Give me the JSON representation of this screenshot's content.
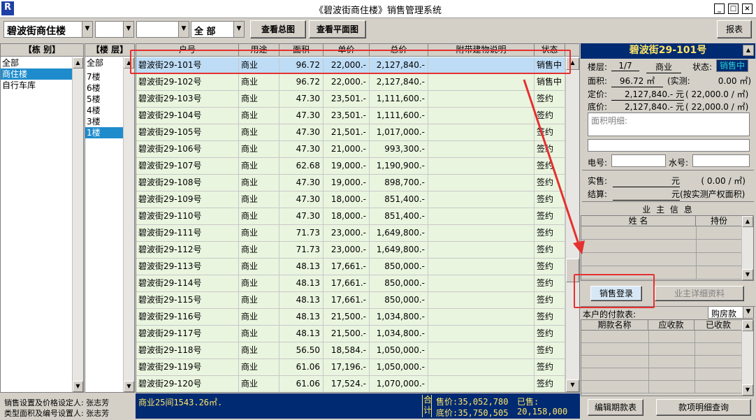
{
  "window": {
    "title": "《碧波街商住楼》销售管理系统",
    "app_icon": "R"
  },
  "toolbar": {
    "building": "碧波街商住楼",
    "combo2": "",
    "combo3": "",
    "scope": "全 部",
    "btn_overview": "查看总图",
    "btn_plan": "查看平面图",
    "btn_report": "报表"
  },
  "buildings": {
    "header": "【栋 别】",
    "items": [
      "全部",
      "商住楼",
      "自行车库"
    ],
    "selected": 1
  },
  "floors": {
    "header": "【楼 层】",
    "items": [
      "全部",
      "7楼",
      "6楼",
      "5楼",
      "4楼",
      "3楼",
      "1楼"
    ],
    "selected": 6
  },
  "grid": {
    "headers": [
      "户号",
      "用途",
      "面积",
      "单价",
      "总价",
      "附带建物说明",
      "状态"
    ],
    "rows": [
      [
        "碧波街29-101号",
        "商业",
        "96.72",
        "22,000.-",
        "2,127,840.-",
        "",
        "销售中"
      ],
      [
        "碧波街29-102号",
        "商业",
        "96.72",
        "22,000.-",
        "2,127,840.-",
        "",
        "销售中"
      ],
      [
        "碧波街29-103号",
        "商业",
        "47.30",
        "23,501.-",
        "1,111,600.-",
        "",
        "签约"
      ],
      [
        "碧波街29-104号",
        "商业",
        "47.30",
        "23,501.-",
        "1,111,600.-",
        "",
        "签约"
      ],
      [
        "碧波街29-105号",
        "商业",
        "47.30",
        "21,501.-",
        "1,017,000.-",
        "",
        "签约"
      ],
      [
        "碧波街29-106号",
        "商业",
        "47.30",
        "21,000.-",
        "993,300.-",
        "",
        "签约"
      ],
      [
        "碧波街29-107号",
        "商业",
        "62.68",
        "19,000.-",
        "1,190,900.-",
        "",
        "签约"
      ],
      [
        "碧波街29-108号",
        "商业",
        "47.30",
        "19,000.-",
        "898,700.-",
        "",
        "签约"
      ],
      [
        "碧波街29-109号",
        "商业",
        "47.30",
        "18,000.-",
        "851,400.-",
        "",
        "签约"
      ],
      [
        "碧波街29-110号",
        "商业",
        "47.30",
        "18,000.-",
        "851,400.-",
        "",
        "签约"
      ],
      [
        "碧波街29-111号",
        "商业",
        "71.73",
        "23,000.-",
        "1,649,800.-",
        "",
        "签约"
      ],
      [
        "碧波街29-112号",
        "商业",
        "71.73",
        "23,000.-",
        "1,649,800.-",
        "",
        "签约"
      ],
      [
        "碧波街29-113号",
        "商业",
        "48.13",
        "17,661.-",
        "850,000.-",
        "",
        "签约"
      ],
      [
        "碧波街29-114号",
        "商业",
        "48.13",
        "17,661.-",
        "850,000.-",
        "",
        "签约"
      ],
      [
        "碧波街29-115号",
        "商业",
        "48.13",
        "17,661.-",
        "850,000.-",
        "",
        "签约"
      ],
      [
        "碧波街29-116号",
        "商业",
        "48.13",
        "21,500.-",
        "1,034,800.-",
        "",
        "签约"
      ],
      [
        "碧波街29-117号",
        "商业",
        "48.13",
        "21,500.-",
        "1,034,800.-",
        "",
        "签约"
      ],
      [
        "碧波街29-118号",
        "商业",
        "56.50",
        "18,584.-",
        "1,050,000.-",
        "",
        "签约"
      ],
      [
        "碧波街29-119号",
        "商业",
        "61.06",
        "17,196.-",
        "1,050,000.-",
        "",
        "签约"
      ],
      [
        "碧波街29-120号",
        "商业",
        "61.06",
        "17,524.-",
        "1,070,000.-",
        "",
        "签约"
      ]
    ],
    "selected": 0
  },
  "summary": {
    "count_text": "商业25间1543.26㎡.",
    "total_label": "合计",
    "sale_label": "售价:",
    "sale_value": "35,052,780",
    "floor_label": "底价:",
    "floor_value": "35,750,505",
    "sold_label": "已售:",
    "sold_value": "20,158,000"
  },
  "left_status": {
    "line1_label": "销售设置及价格设定人:",
    "line1_value": "张志芳",
    "line2_label": "类型面积及编号设置人:",
    "line2_value": "张志芳"
  },
  "detail": {
    "title": "碧波街29-101号",
    "floor_label": "楼层:",
    "floor_value": "1/7",
    "use_value": "商业",
    "status_label": "状态:",
    "status_value": "销售中",
    "area_label": "面积:",
    "area_value": "96.72 ㎡",
    "actual_label": "(实测:",
    "actual_value": "0.00 ㎡)",
    "price_label": "定价:",
    "price_value": "2,127,840.- 元",
    "price_unit": "( 22,000.0 / ㎡)",
    "base_label": "底价:",
    "base_value": "2,127,840.- 元",
    "base_unit": "( 22,000.0 / ㎡)",
    "area_detail_placeholder": "面积明细:",
    "elec_label": "电号:",
    "water_label": "水号:",
    "real_label": "实售:",
    "real_value": "元",
    "real_unit": "( 0.00 / ㎡)",
    "settle_label": "结算:",
    "settle_value": "元",
    "settle_note": "(按实测产权面积)",
    "owner_title": "业 主 信 息",
    "owner_col_name": "姓 名",
    "owner_col_share": "持份",
    "btn_register": "销售登录",
    "btn_owner_detail": "业主详细资料",
    "payment_label": "本户的付款表:",
    "payment_type": "购房款",
    "pay_col1": "期款名称",
    "pay_col2": "应收款",
    "pay_col3": "已收款",
    "btn_edit_schedule": "编辑期款表",
    "btn_payment_detail": "款项明细查询"
  },
  "colors": {
    "selected_blue": "#1e8ccc",
    "row_green": "#eaf5df",
    "navy": "#002a72",
    "highlight_red": "#e53030",
    "status_cyan": "#2ad0d0"
  }
}
